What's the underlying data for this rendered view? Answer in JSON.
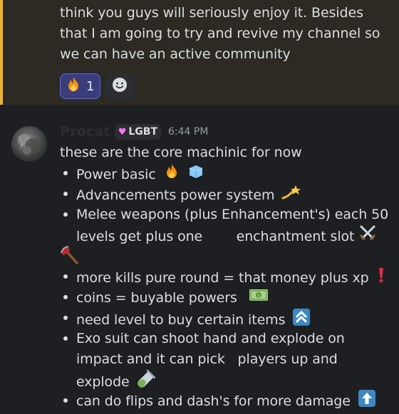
{
  "previous_message": {
    "lines": [
      "think you guys will seriously enjoy it. Besides",
      "that I am going to try and revive my channel so",
      "we can have an active community"
    ],
    "reactions": [
      {
        "emoji": "fire-emoji",
        "count": "1",
        "active": true
      },
      {
        "emoji": "add-reaction-icon",
        "count": "",
        "active": false
      }
    ]
  },
  "message": {
    "username": "Procat",
    "tag": "LGBT",
    "tag_icon": "pink-heart-icon",
    "timestamp": "6:44 PM",
    "intro": "these are the core machinic for now",
    "bullets": [
      {
        "text": "Power basic",
        "emojis": [
          "fire-emoji",
          "ice-cube-emoji"
        ]
      },
      {
        "text": "Advancements power system",
        "emojis": [
          "dizzy-emoji"
        ]
      },
      {
        "text": "Melee weapons (plus Enhancement's) each 50",
        "cont": "levels get plus one        enchantment slot",
        "emojis": [
          "crossed-swords-emoji",
          "axe-emoji"
        ]
      },
      {
        "text": "more kills pure round = that money plus xp",
        "emojis": [
          "exclamation-emoji"
        ]
      },
      {
        "text": "coins = buyable powers",
        "emojis": [
          "dollar-banknote-emoji"
        ]
      },
      {
        "text": "need level to buy certain items",
        "emojis": [
          "double-up-arrow-emoji"
        ]
      },
      {
        "text": "Exo suit can shoot hand and explode on",
        "cont": "impact and it can pick   players up and",
        "cont2": "explode",
        "emojis": [
          "test-tube-emoji"
        ]
      },
      {
        "text": "can do flips and dash's for more damage",
        "emojis": [
          "up-arrow-emoji"
        ]
      }
    ]
  },
  "colors": {
    "background": "#1e1f22",
    "highlight_bg": "#2c2a22",
    "highlight_bar": "#f0b132",
    "reaction_active": "#5865f2",
    "text": "#dbdee1",
    "timestamp": "#949ba4"
  }
}
